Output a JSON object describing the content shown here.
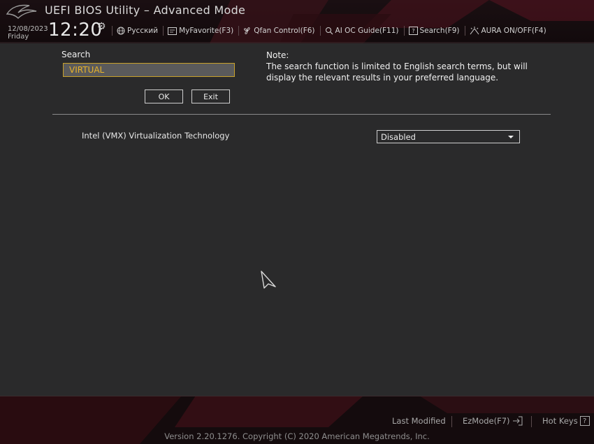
{
  "header": {
    "title": "UEFI BIOS Utility – Advanced Mode",
    "date": "12/08/2023",
    "day": "Friday",
    "time": "12:20",
    "toolbar": [
      {
        "label": "Русский",
        "icon": "globe-icon"
      },
      {
        "label": "MyFavorite(F3)",
        "icon": "favorite-icon"
      },
      {
        "label": "Qfan Control(F6)",
        "icon": "fan-icon"
      },
      {
        "label": "AI OC Guide(F11)",
        "icon": "ai-guide-icon"
      },
      {
        "label": "Search(F9)",
        "icon": "search-icon"
      },
      {
        "label": "AURA ON/OFF(F4)",
        "icon": "aura-icon"
      }
    ]
  },
  "search": {
    "label": "Search",
    "value": "VIRTUAL",
    "ok_label": "OK",
    "exit_label": "Exit"
  },
  "note": {
    "title": "Note:",
    "text": "The search function is limited to English search terms, but will display the relevant results in your preferred language."
  },
  "results": [
    {
      "label": "Intel (VMX) Virtualization Technology",
      "value": "Disabled"
    }
  ],
  "footer": {
    "last_modified": "Last Modified",
    "ezmode": "EzMode(F7)",
    "hotkeys": "Hot Keys",
    "hotkeys_glyph": "?",
    "version": "Version 2.20.1276. Copyright (C) 2020 American Megatrends, Inc."
  },
  "colors": {
    "accent_yellow": "#e8b32a",
    "header_red": "#6a1420",
    "background": "#2a2a2b"
  }
}
